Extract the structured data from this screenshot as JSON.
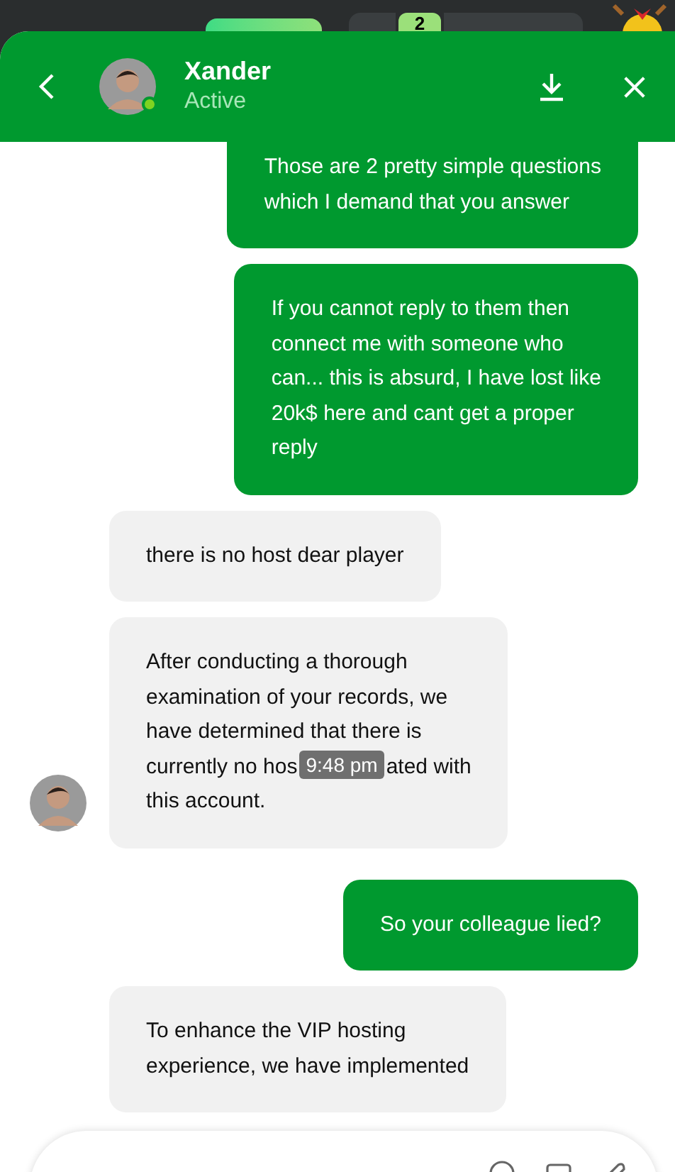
{
  "top_bar": {
    "badge": "2"
  },
  "header": {
    "name": "Xander",
    "status": "Active",
    "online": true
  },
  "messages": [
    {
      "kind": "outgoing",
      "cut_top": true,
      "lines": [
        {
          "text": "Those are 2 pretty simple questions"
        },
        {
          "text": "which I demand that you answer"
        }
      ]
    },
    {
      "kind": "outgoing",
      "lines": [
        {
          "text": "If you cannot reply to them then"
        },
        {
          "text": "connect me with someone who"
        },
        {
          "text": "can... this is absurd, I have lost like"
        },
        {
          "text": "20k$ here and cant get a proper"
        },
        {
          "text": "reply"
        }
      ]
    },
    {
      "kind": "incoming",
      "lines": [
        {
          "text": "there is no host dear player"
        }
      ]
    },
    {
      "kind": "incoming",
      "avatar": true,
      "lines": [
        {
          "text": "After conducting a thorough"
        },
        {
          "text": "examination of your records, we"
        },
        {
          "text": "have determined that there is"
        },
        {
          "parts": [
            "currently no hos",
            "ated with"
          ],
          "tooltip": "9:48 pm"
        },
        {
          "text": "this account."
        }
      ]
    },
    {
      "kind": "outgoing",
      "lines": [
        {
          "text": "So your colleague lied?"
        }
      ]
    },
    {
      "kind": "incoming",
      "lines": [
        {
          "text": "To enhance the VIP hosting"
        },
        {
          "text": "experience, we have implemented"
        }
      ]
    }
  ]
}
